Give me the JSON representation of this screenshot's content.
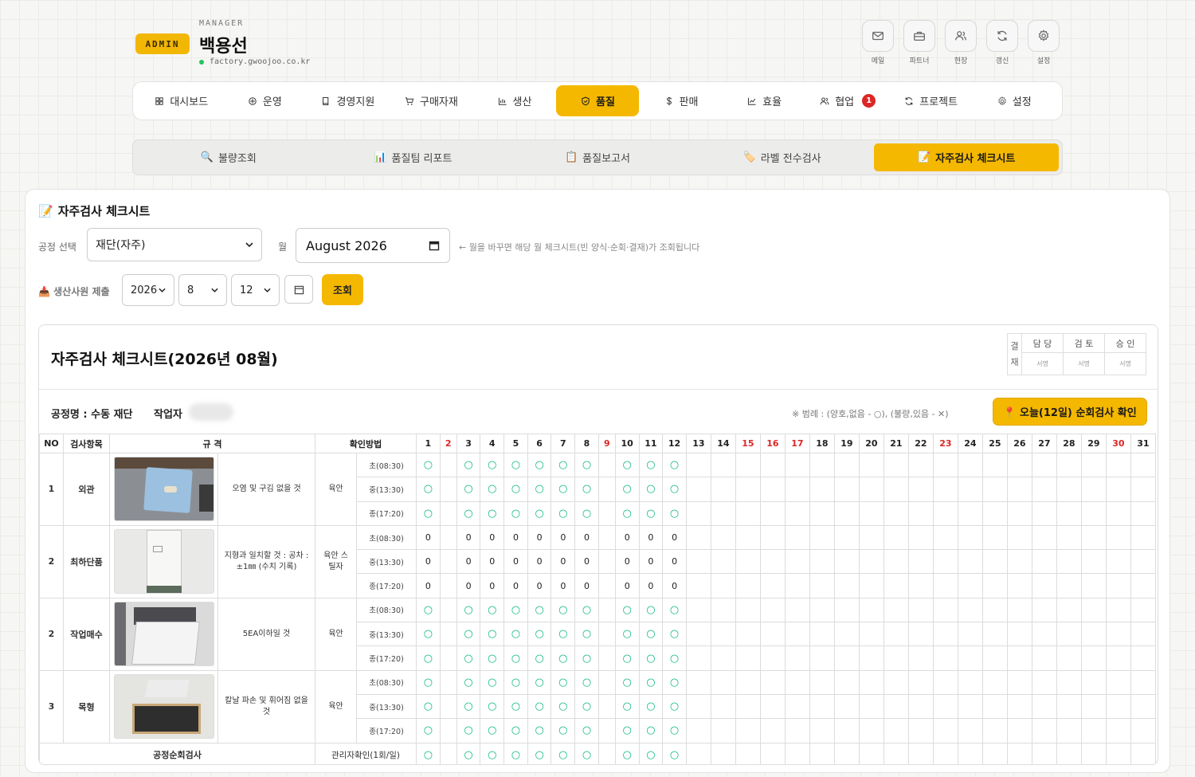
{
  "header": {
    "badge": "ADMIN",
    "role": "MANAGER",
    "name": "백용선",
    "domain": "factory.gwoojoo.co.kr",
    "quick": [
      {
        "label": "메일",
        "icon": "mail-icon"
      },
      {
        "label": "파트너",
        "icon": "briefcase-icon"
      },
      {
        "label": "현장",
        "icon": "users-icon"
      },
      {
        "label": "갱신",
        "icon": "refresh-icon"
      },
      {
        "label": "설정",
        "icon": "gear-icon"
      }
    ]
  },
  "nav": [
    {
      "label": "대시보드",
      "icon": "grid-icon"
    },
    {
      "label": "운영",
      "icon": "crosshair-icon"
    },
    {
      "label": "경영지원",
      "icon": "book-icon"
    },
    {
      "label": "구매자재",
      "icon": "cart-icon"
    },
    {
      "label": "생산",
      "icon": "chart-icon"
    },
    {
      "label": "품질",
      "icon": "shield-icon",
      "active": true
    },
    {
      "label": "판매",
      "icon": "dollar-icon"
    },
    {
      "label": "효율",
      "icon": "trend-icon"
    },
    {
      "label": "협업",
      "icon": "team-icon",
      "badge": "1"
    },
    {
      "label": "프로젝트",
      "icon": "cycle-icon"
    },
    {
      "label": "설정",
      "icon": "gear-icon"
    }
  ],
  "subnav": [
    {
      "label": "불량조회",
      "emoji": "🔍"
    },
    {
      "label": "품질팀 리포트",
      "emoji": "📊"
    },
    {
      "label": "품질보고서",
      "emoji": "📋"
    },
    {
      "label": "라벨 전수검사",
      "emoji": "🏷️"
    },
    {
      "label": "자주검사 체크시트",
      "emoji": "📝",
      "active": true
    }
  ],
  "panel": {
    "title_emoji": "📝",
    "title": "자주검사 체크시트",
    "process_label": "공정 선택",
    "process_value": "재단(자주)",
    "month_label": "월",
    "month_value": "August 2026",
    "hint": "← 월을 바꾸면 해당 월 체크시트(빈 양식·순회·결재)가 조회됩니다",
    "submit_label": "📥 생산사원 제출",
    "year": "2026",
    "month": "8",
    "day": "12",
    "query_button": "조회"
  },
  "sheet": {
    "title": "자주검사 체크시트(2026년 08월)",
    "approval": {
      "label": "결재",
      "cols": [
        "담 당",
        "검 토",
        "승 인"
      ],
      "sig": "서명"
    },
    "process_name": "공정명 : 수동 재단",
    "worker_label": "작업자",
    "legend": "※ 범례 : (양호,없음 - ○), (불량,있음 - ✕)",
    "today_button": "📍 오늘(12일) 순회검사 확인",
    "headers": {
      "no": "NO",
      "item": "검사항목",
      "spec": "규 격",
      "method": "확인방법"
    },
    "days": 31,
    "red_days": [
      2,
      9,
      15,
      16,
      17,
      23,
      30
    ],
    "filled_days": [
      1,
      3,
      4,
      5,
      6,
      7,
      8,
      10,
      11,
      12
    ],
    "ok_mark": "○",
    "shifts": [
      "초(08:30)",
      "중(13:30)",
      "종(17:20)"
    ],
    "rows": [
      {
        "no": "1",
        "item": "외관",
        "spec": "오염 및 구김 없을 것",
        "method": "육안",
        "mark": "○",
        "image": "fabric"
      },
      {
        "no": "2",
        "item": "최하단품",
        "spec": "지형과 일치할 것 : 공차 : ±1㎜ (수치 기록)",
        "method": "육안 스틸자",
        "mark": "0",
        "image": "pattern"
      },
      {
        "no": "2",
        "item": "작업매수",
        "spec": "5EA이하일 것",
        "method": "육안",
        "mark": "○",
        "image": "stack"
      },
      {
        "no": "3",
        "item": "목형",
        "spec": "칼날 파손 및 휘어짐 없을 것",
        "method": "육안",
        "mark": "○",
        "image": "die"
      }
    ],
    "footer": {
      "label": "공정순회검사",
      "check": "관리자확인(1회/일)"
    }
  }
}
